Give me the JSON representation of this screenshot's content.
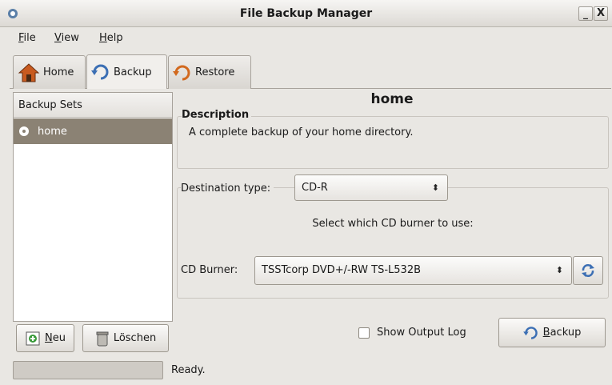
{
  "window": {
    "title": "File Backup Manager",
    "minimize": "_",
    "close": "X"
  },
  "menu": [
    "File",
    "View",
    "Help"
  ],
  "tabs": {
    "home": "Home",
    "backup": "Backup",
    "restore": "Restore",
    "active": "backup"
  },
  "sets": {
    "header": "Backup Sets",
    "items": [
      "home"
    ]
  },
  "buttons": {
    "new": "Neu",
    "delete": "Löschen",
    "backup": "Backup"
  },
  "detail": {
    "title": "home",
    "description_label": "Description",
    "description_text": "A complete backup of your home directory.",
    "destination_label": "Destination type:",
    "destination_value": "CD-R",
    "select_burner_text": "Select which CD burner to use:",
    "burner_label": "CD Burner:",
    "burner_value": "TSSTcorp DVD+/-RW TS-L532B"
  },
  "options": {
    "show_output_log": "Show Output Log",
    "show_output_log_checked": false
  },
  "status": {
    "text": "Ready.",
    "progress": 0
  },
  "colors": {
    "selection": "#8b8274",
    "home_icon": "#c85a1f",
    "arrow_icon": "#3c6fb4",
    "restore_icon": "#d2691e"
  }
}
